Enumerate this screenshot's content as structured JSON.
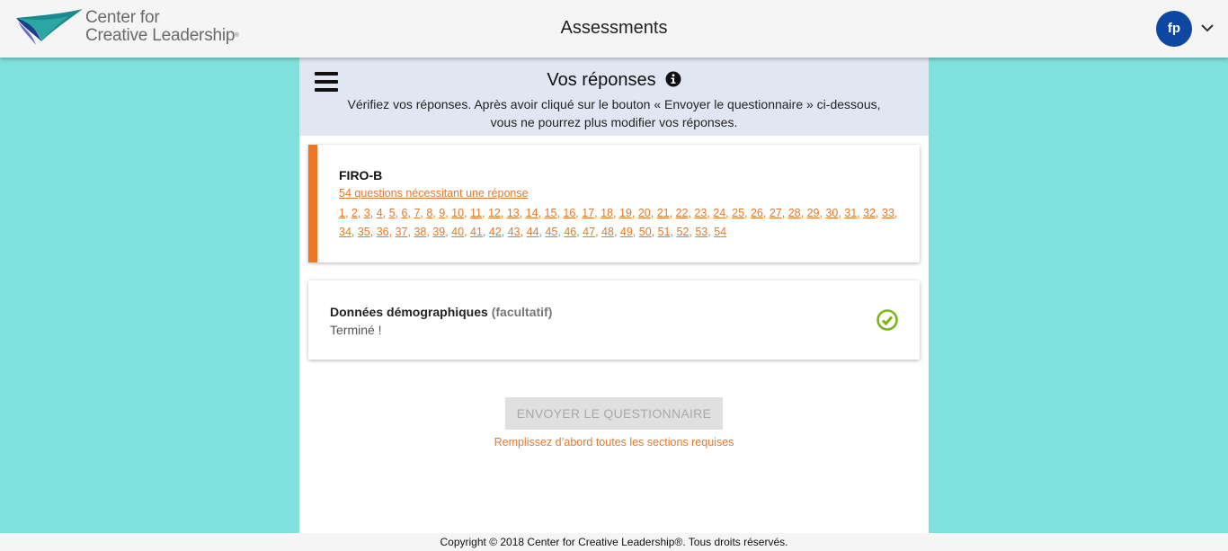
{
  "header": {
    "logo_line1": "Center for",
    "logo_line2": "Creative Leadership",
    "title": "Assessments",
    "avatar_initials": "fp",
    "menu_icon": "chevron-down-icon"
  },
  "panel": {
    "title": "Vos réponses",
    "description": "Vérifiez vos réponses. Après avoir cliqué sur le bouton « Envoyer le questionnaire » ci-dessous, vous ne pourrez plus modifier vos réponses."
  },
  "sections": {
    "firo": {
      "name": "FIRO-B",
      "link": "54 questions nécessitant une réponse",
      "questions": [
        "1",
        "2",
        "3",
        "4",
        "5",
        "6",
        "7",
        "8",
        "9",
        "10",
        "11",
        "12",
        "13",
        "14",
        "15",
        "16",
        "17",
        "18",
        "19",
        "20",
        "21",
        "22",
        "23",
        "24",
        "25",
        "26",
        "27",
        "28",
        "29",
        "30",
        "31",
        "32",
        "33",
        "34",
        "35",
        "36",
        "37",
        "38",
        "39",
        "40",
        "41",
        "42",
        "43",
        "44",
        "45",
        "46",
        "47",
        "48",
        "49",
        "50",
        "51",
        "52",
        "53",
        "54"
      ],
      "accent": "#ee7524"
    },
    "demographics": {
      "name": "Données démographiques",
      "optional": "(facultatif)",
      "status": "Terminé !",
      "status_color": "#7cb518"
    }
  },
  "submit": {
    "label": "ENVOYER LE QUESTIONNAIRE",
    "hint": "Remplissez d’abord toutes les sections requises"
  },
  "footer": {
    "copyright": "Copyright © 2018 Center for Creative Leadership®. Tous droits réservés."
  }
}
